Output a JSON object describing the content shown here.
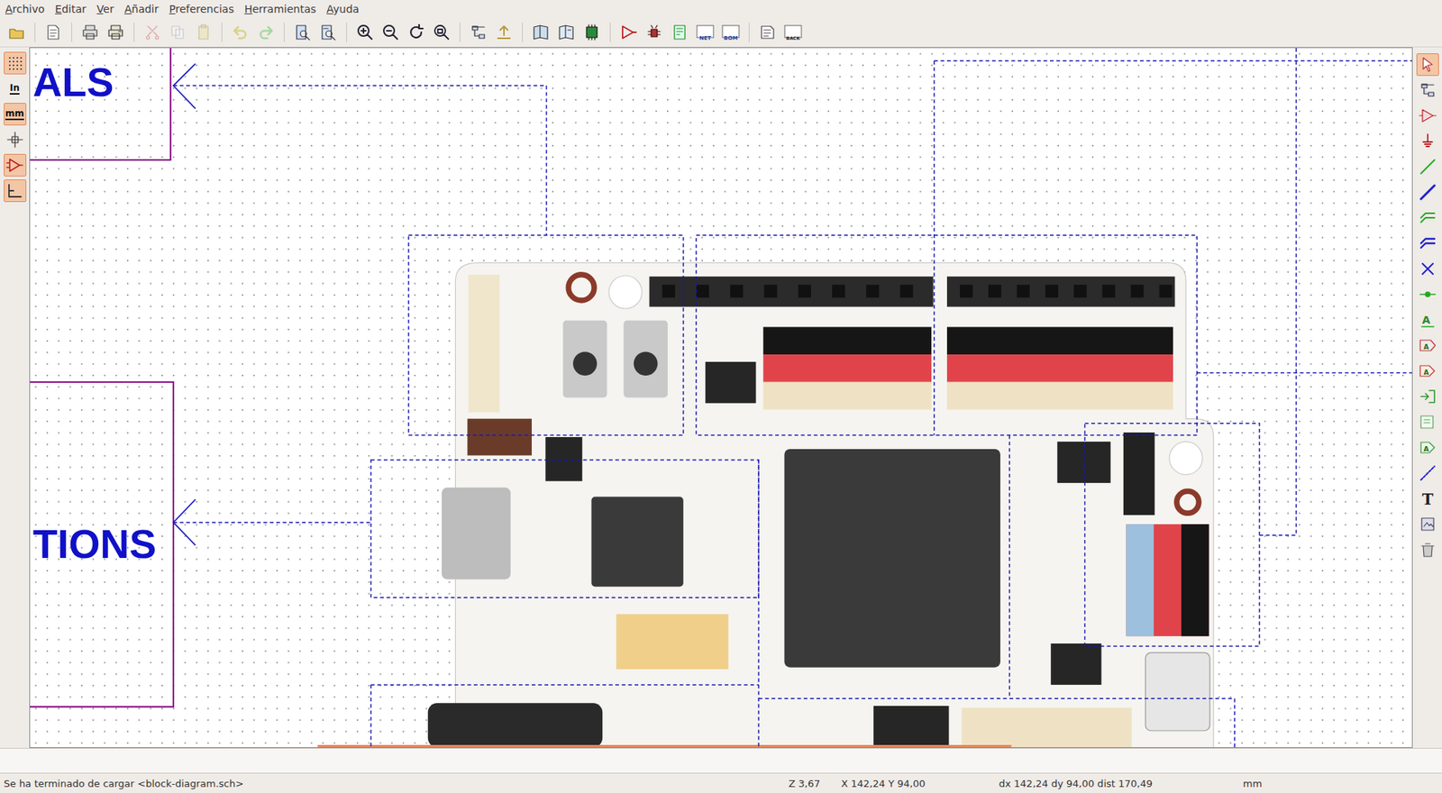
{
  "window": {
    "app": "Eeschema"
  },
  "menu": [
    {
      "label": "Archivo"
    },
    {
      "label": "Editar"
    },
    {
      "label": "Ver"
    },
    {
      "label": "Añadir"
    },
    {
      "label": "Preferencias"
    },
    {
      "label": "Herramientas"
    },
    {
      "label": "Ayuda"
    }
  ],
  "toolbar": {
    "net": "NET",
    "bom": "BOM",
    "back": "BACK"
  },
  "left_toolbar": [
    {
      "label": "",
      "on": true
    },
    {
      "label": "In",
      "on": false
    },
    {
      "label": "mm",
      "on": true
    },
    {
      "label": "",
      "on": false
    },
    {
      "label": "",
      "on": true
    },
    {
      "label": "",
      "on": true
    }
  ],
  "right_toolbar": [
    {
      "label": "",
      "on": true
    },
    {
      "label": "",
      "on": false
    },
    {
      "label": "",
      "on": false
    },
    {
      "label": "",
      "on": false
    },
    {
      "label": "",
      "on": false
    },
    {
      "label": "",
      "on": false
    },
    {
      "label": "",
      "on": false
    },
    {
      "label": "",
      "on": false
    },
    {
      "label": "",
      "on": false
    },
    {
      "label": "",
      "on": false
    },
    {
      "label": "A",
      "on": false
    },
    {
      "label": "A",
      "on": false
    },
    {
      "label": "A",
      "on": false
    },
    {
      "label": "",
      "on": false
    },
    {
      "label": "",
      "on": false
    },
    {
      "label": "A",
      "on": false
    },
    {
      "label": "",
      "on": false
    },
    {
      "label": "T",
      "on": false
    },
    {
      "label": "",
      "on": false
    },
    {
      "label": "",
      "on": false
    }
  ],
  "canvas": {
    "sheets": [
      {
        "label": "ALS"
      },
      {
        "label": "TIONS"
      }
    ]
  },
  "message_panel": {
    "text": ""
  },
  "status_bar": {
    "message": "Se ha terminado de cargar <block-diagram.sch>",
    "zoom": "Z 3,67",
    "position": "X 142,24 Y 94,00",
    "delta": "dx 142,24 dy 94,00 dist 170,49",
    "units": "mm"
  }
}
